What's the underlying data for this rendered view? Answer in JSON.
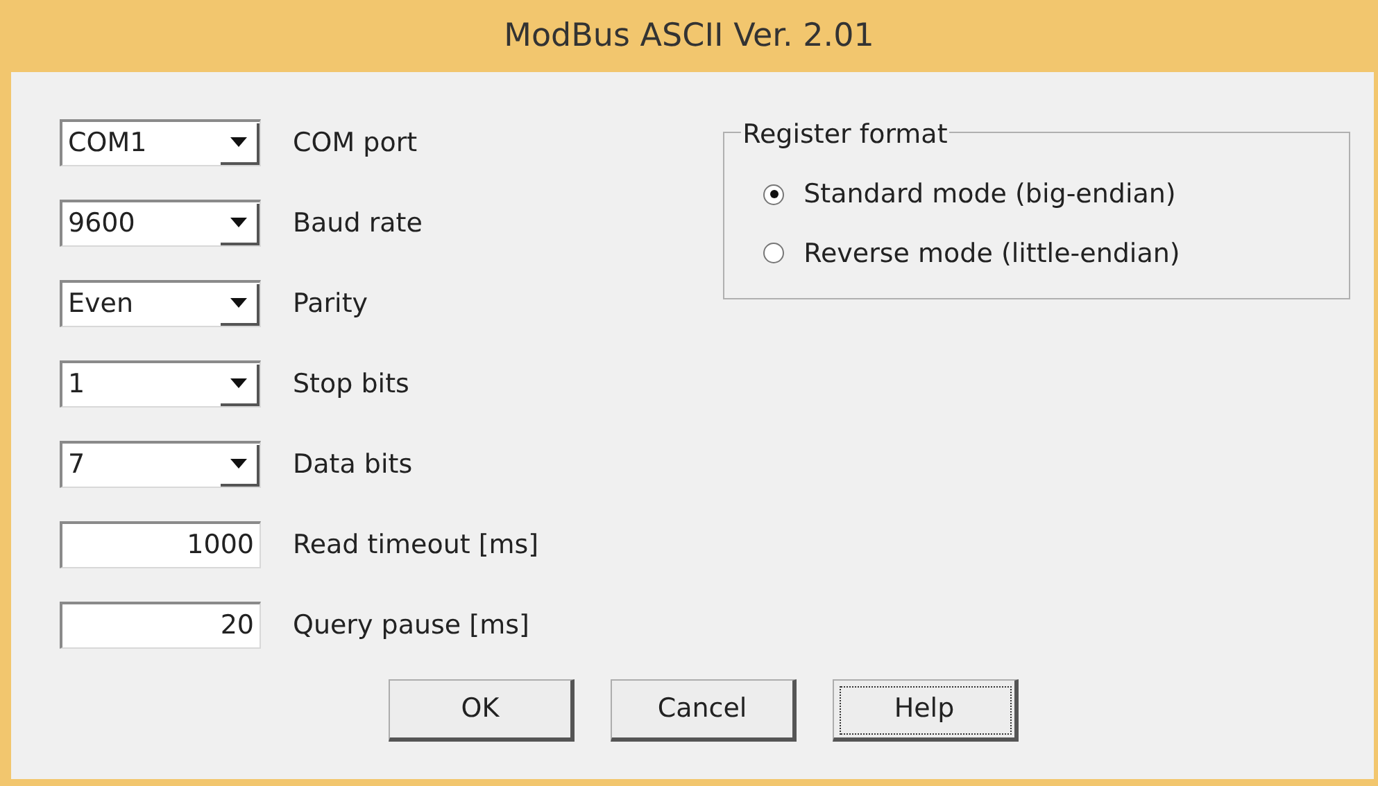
{
  "window": {
    "title": "ModBus ASCII  Ver. 2.01"
  },
  "fields": [
    {
      "kind": "combo",
      "value": "COM1",
      "label": "COM port"
    },
    {
      "kind": "combo",
      "value": "9600",
      "label": "Baud rate"
    },
    {
      "kind": "combo",
      "value": "Even",
      "label": "Parity"
    },
    {
      "kind": "combo",
      "value": "1",
      "label": "Stop bits"
    },
    {
      "kind": "combo",
      "value": "7",
      "label": "Data bits"
    },
    {
      "kind": "number",
      "value": "1000",
      "label": "Read timeout [ms]"
    },
    {
      "kind": "number",
      "value": "20",
      "label": "Query pause [ms]"
    }
  ],
  "register_format": {
    "title": "Register format",
    "options": [
      {
        "label": "Standard mode (big-endian)",
        "selected": true
      },
      {
        "label": "Reverse mode (little-endian)",
        "selected": false
      }
    ]
  },
  "buttons": [
    {
      "label": "OK",
      "focused": false
    },
    {
      "label": "Cancel",
      "focused": false
    },
    {
      "label": "Help",
      "focused": true
    }
  ]
}
